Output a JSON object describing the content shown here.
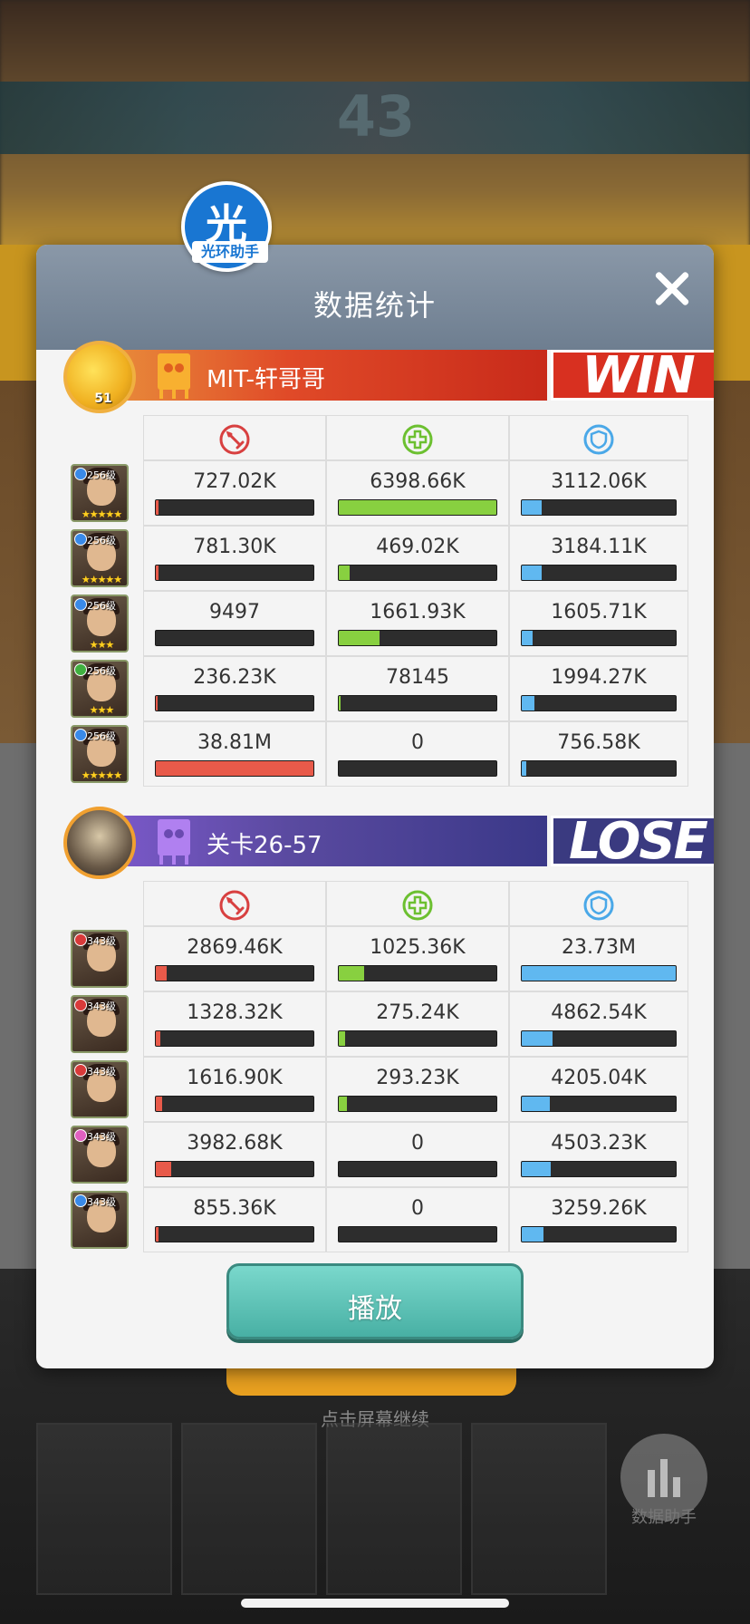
{
  "background": {
    "score": "43",
    "caption": "点击屏幕继续",
    "stats_label": "数据助手"
  },
  "helper": {
    "char": "光",
    "label": "光环助手"
  },
  "dialog": {
    "title": "数据统计",
    "play_label": "播放"
  },
  "colors": {
    "damage": "#e85a4a",
    "heal": "#88d040",
    "defense": "#60b8f0",
    "win": "#d83020",
    "lose": "#3a3a80"
  },
  "stat_icons": [
    "sword-icon",
    "heal-cross-icon",
    "shield-icon"
  ],
  "teams": [
    {
      "name": "MIT-轩哥哥",
      "result": "WIN",
      "level": "51",
      "heroes": [
        {
          "level": "256级",
          "element": "#3a8ae8",
          "stars": "★★★★★",
          "damage": "727.02K",
          "damage_pct": 0.02,
          "heal": "6398.66K",
          "heal_pct": 1.0,
          "defense": "3112.06K",
          "defense_pct": 0.13
        },
        {
          "level": "256级",
          "element": "#3a8ae8",
          "stars": "★★★★★",
          "damage": "781.30K",
          "damage_pct": 0.02,
          "heal": "469.02K",
          "heal_pct": 0.07,
          "defense": "3184.11K",
          "defense_pct": 0.13
        },
        {
          "level": "256级",
          "element": "#3a8ae8",
          "stars": "★★★",
          "damage": "9497",
          "damage_pct": 0.0,
          "heal": "1661.93K",
          "heal_pct": 0.26,
          "defense": "1605.71K",
          "defense_pct": 0.07
        },
        {
          "level": "256级",
          "element": "#40b040",
          "stars": "★★★",
          "damage": "236.23K",
          "damage_pct": 0.01,
          "heal": "78145",
          "heal_pct": 0.01,
          "defense": "1994.27K",
          "defense_pct": 0.08
        },
        {
          "level": "256级",
          "element": "#3a8ae8",
          "stars": "★★★★★",
          "damage": "38.81M",
          "damage_pct": 1.0,
          "heal": "0",
          "heal_pct": 0.0,
          "defense": "756.58K",
          "defense_pct": 0.03
        }
      ]
    },
    {
      "name": "关卡26-57",
      "result": "LOSE",
      "level": "",
      "heroes": [
        {
          "level": "343级",
          "element": "#d83a3a",
          "stars": "",
          "damage": "2869.46K",
          "damage_pct": 0.07,
          "heal": "1025.36K",
          "heal_pct": 0.16,
          "defense": "23.73M",
          "defense_pct": 1.0
        },
        {
          "level": "343级",
          "element": "#d83a3a",
          "stars": "",
          "damage": "1328.32K",
          "damage_pct": 0.03,
          "heal": "275.24K",
          "heal_pct": 0.04,
          "defense": "4862.54K",
          "defense_pct": 0.2
        },
        {
          "level": "343级",
          "element": "#d83a3a",
          "stars": "",
          "damage": "1616.90K",
          "damage_pct": 0.04,
          "heal": "293.23K",
          "heal_pct": 0.05,
          "defense": "4205.04K",
          "defense_pct": 0.18
        },
        {
          "level": "343级",
          "element": "#e060c0",
          "stars": "",
          "damage": "3982.68K",
          "damage_pct": 0.1,
          "heal": "0",
          "heal_pct": 0.0,
          "defense": "4503.23K",
          "defense_pct": 0.19
        },
        {
          "level": "343级",
          "element": "#3a8ae8",
          "stars": "",
          "damage": "855.36K",
          "damage_pct": 0.02,
          "heal": "0",
          "heal_pct": 0.0,
          "defense": "3259.26K",
          "defense_pct": 0.14
        }
      ]
    }
  ]
}
